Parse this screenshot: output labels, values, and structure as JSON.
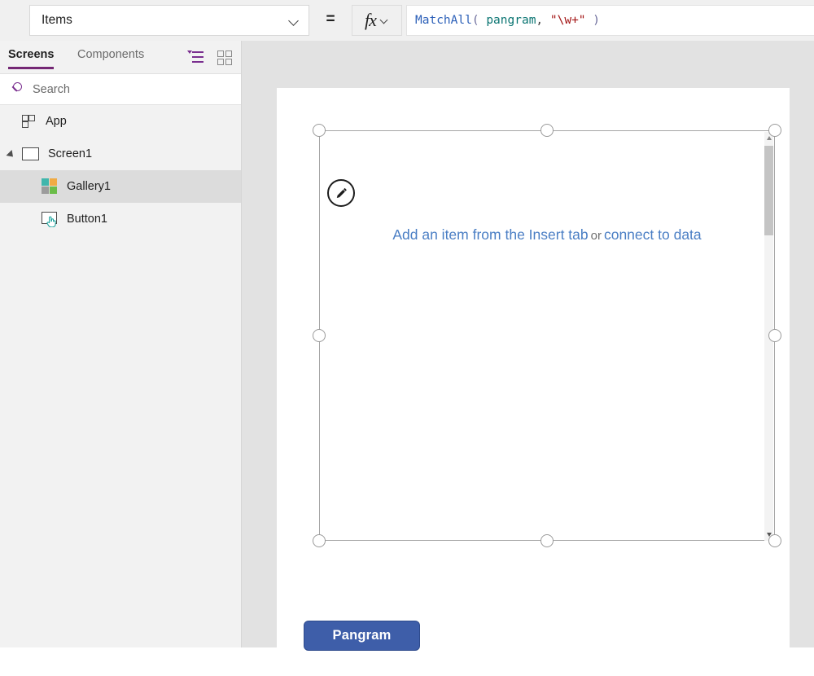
{
  "formula_bar": {
    "property_select": {
      "value": "Items",
      "dropdown_icon": "chevron-down-icon"
    },
    "equals": "=",
    "fx_button": {
      "glyph": "fx",
      "dropdown_icon": "chevron-down-icon"
    },
    "formula_plain": "MatchAll( pangram, \"\\w+\" )",
    "formula_tokens": [
      {
        "text": "MatchAll",
        "type": "function"
      },
      {
        "text": "(",
        "type": "paren"
      },
      {
        "text": " ",
        "type": "punc"
      },
      {
        "text": "pangram",
        "type": "identifier"
      },
      {
        "text": ",",
        "type": "punc"
      },
      {
        "text": " ",
        "type": "punc"
      },
      {
        "text": "\"\\w+\"",
        "type": "string"
      },
      {
        "text": " ",
        "type": "punc"
      },
      {
        "text": ")",
        "type": "paren"
      }
    ]
  },
  "sidebar": {
    "tabs": [
      {
        "label": "Screens",
        "active": true
      },
      {
        "label": "Components",
        "active": false
      }
    ],
    "header_icons": [
      {
        "name": "list-sort-icon",
        "color": "#7a2f8f"
      },
      {
        "name": "grid-view-icon",
        "color": "#8a8a8a"
      }
    ],
    "search": {
      "placeholder": "Search",
      "value": "",
      "icon": "search-icon"
    },
    "tree": [
      {
        "label": "App",
        "icon": "app-icon",
        "depth": 0,
        "selected": false,
        "expandable": false
      },
      {
        "label": "Screen1",
        "icon": "screen-icon",
        "depth": 0,
        "selected": false,
        "expandable": true,
        "expanded": true
      },
      {
        "label": "Gallery1",
        "icon": "gallery-icon",
        "depth": 1,
        "selected": true,
        "expandable": false
      },
      {
        "label": "Button1",
        "icon": "button-icon",
        "depth": 1,
        "selected": false,
        "expandable": false
      }
    ]
  },
  "canvas": {
    "gallery": {
      "empty_text_prefix": "Add an item from the Insert tab",
      "empty_text_middle": "or",
      "empty_text_suffix": "connect to data",
      "selected": true,
      "edit_icon": "pencil-icon",
      "scrollbar": {
        "up_icon": "caret-up-icon",
        "down_icon": "caret-down-icon"
      }
    },
    "button": {
      "label": "Pangram",
      "fill": "#3e5ea9",
      "text_color": "#ffffff"
    }
  },
  "colors": {
    "accent_purple": "#742774",
    "canvas_gray": "#e2e2e2",
    "sidebar_gray": "#f2f2f2",
    "link_blue": "#4a7ec4",
    "selection_gray": "#dcdcdc"
  }
}
